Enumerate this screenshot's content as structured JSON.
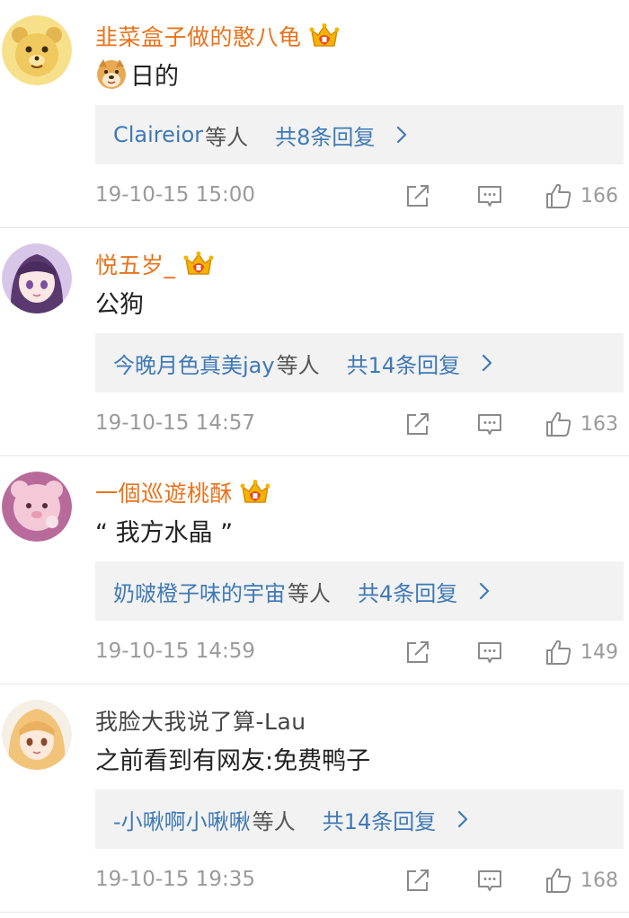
{
  "comments": [
    {
      "username": "韭菜盒子做的憨八龟",
      "vip": true,
      "emoji": "doge-icon",
      "text": "日的",
      "reply_users": "Claireior",
      "reply_suffix": "等人",
      "reply_count": "共8条回复",
      "timestamp": "19-10-15 15:00",
      "likes": "166"
    },
    {
      "username": "悦五岁_",
      "vip": true,
      "text": "公狗",
      "reply_users": "今晚月色真美jay",
      "reply_suffix": "等人",
      "reply_count": "共14条回复",
      "timestamp": "19-10-15 14:57",
      "likes": "163"
    },
    {
      "username": "一個巡遊桃酥",
      "vip": true,
      "text": "“ 我方水晶 ”",
      "reply_users": "奶啵橙子味的宇宙",
      "reply_suffix": "等人",
      "reply_count": "共4条回复",
      "timestamp": "19-10-15 14:59",
      "likes": "149"
    },
    {
      "username": "我脸大我说了算-Lau",
      "vip": false,
      "text": "之前看到有网友:免费鸭子",
      "reply_users": "-小啾啊小啾啾",
      "reply_suffix": "等人",
      "reply_count": "共14条回复",
      "timestamp": "19-10-15 19:35",
      "likes": "168"
    }
  ],
  "colors": {
    "vip_name": "#e8731c",
    "link": "#3f79b5",
    "meta": "#9a9a9a",
    "reply_bg": "#f2f2f2",
    "divider": "#e6e6e6"
  }
}
